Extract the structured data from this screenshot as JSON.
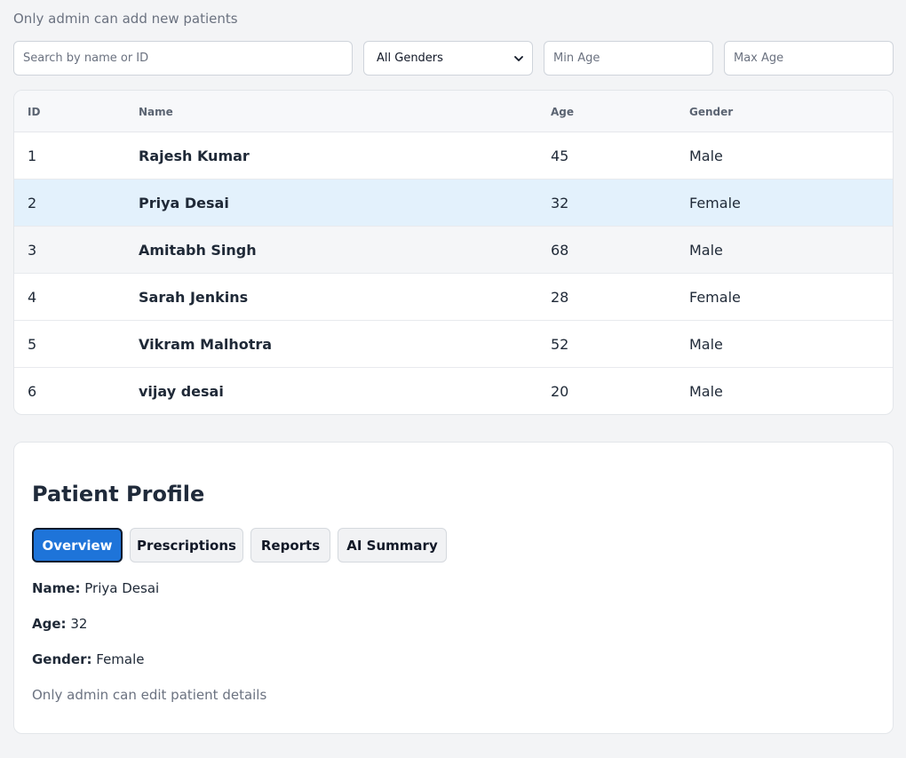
{
  "notice": "Only admin can add new patients",
  "filters": {
    "search_placeholder": "Search by name or ID",
    "gender_selected": "All Genders",
    "min_age_placeholder": "Min Age",
    "max_age_placeholder": "Max Age"
  },
  "table": {
    "headers": {
      "id": "ID",
      "name": "Name",
      "age": "Age",
      "gender": "Gender"
    },
    "rows": [
      {
        "id": "1",
        "name": "Rajesh Kumar",
        "age": "45",
        "gender": "Male"
      },
      {
        "id": "2",
        "name": "Priya Desai",
        "age": "32",
        "gender": "Female"
      },
      {
        "id": "3",
        "name": "Amitabh Singh",
        "age": "68",
        "gender": "Male"
      },
      {
        "id": "4",
        "name": "Sarah Jenkins",
        "age": "28",
        "gender": "Female"
      },
      {
        "id": "5",
        "name": "Vikram Malhotra",
        "age": "52",
        "gender": "Male"
      },
      {
        "id": "6",
        "name": "vijay desai",
        "age": "20",
        "gender": "Male"
      }
    ],
    "selected_row": 2
  },
  "profile": {
    "title": "Patient Profile",
    "tabs": [
      "Overview",
      "Prescriptions",
      "Reports",
      "AI Summary"
    ],
    "active_tab": "Overview",
    "name_label": "Name:",
    "name_value": "Priya Desai",
    "age_label": "Age:",
    "age_value": "32",
    "gender_label": "Gender:",
    "gender_value": "Female",
    "edit_notice": "Only admin can edit patient details"
  },
  "colors": {
    "accent": "#1e74d9",
    "selected_row": "#e3f1fc",
    "page_background": "#f3f4f6"
  },
  "icons": {
    "gender_select": "chevron-down-icon"
  }
}
